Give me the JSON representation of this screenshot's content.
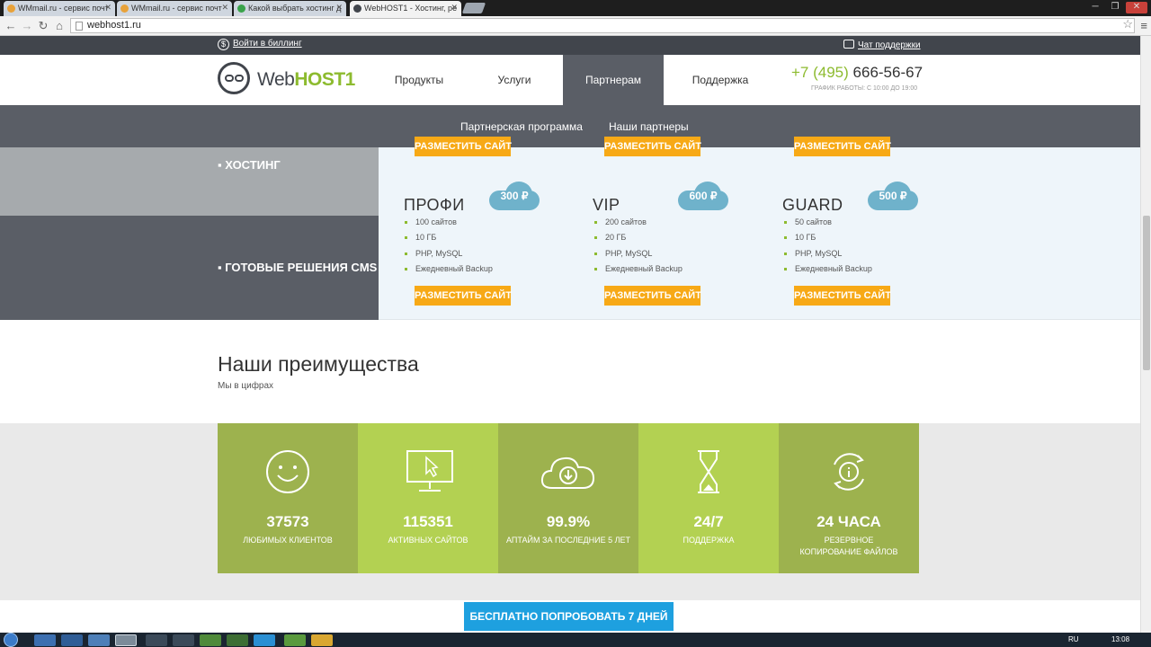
{
  "browser": {
    "tabs": [
      {
        "title": "WMmail.ru - сервис почт",
        "active": false
      },
      {
        "title": "WMmail.ru - сервис почт",
        "active": false
      },
      {
        "title": "Какой выбрать хостинг д",
        "active": false
      },
      {
        "title": "WebHOST1 - Хостинг, ре",
        "active": true
      }
    ],
    "url": "webhost1.ru"
  },
  "topstrip": {
    "billing": "Войти в биллинг",
    "support_chat": "Чат поддержки"
  },
  "header": {
    "logo_web": "Web",
    "logo_host": "HOST1",
    "nav": [
      {
        "label": "Продукты",
        "active": false
      },
      {
        "label": "Услуги",
        "active": false
      },
      {
        "label": "Партнерам",
        "active": true
      },
      {
        "label": "Поддержка",
        "active": false
      }
    ],
    "phone_code": "+7 (495)",
    "phone_number": "666-56-67",
    "hours": "ГРАФИК РАБОТЫ: С 10:00 ДО 19:00"
  },
  "subnav": [
    "Партнерская программа",
    "Наши партнеры"
  ],
  "plans": {
    "categories": [
      "ХОСТИНГ",
      "ГОТОВЫЕ РЕШЕНИЯ CMS"
    ],
    "button_label": "РАЗМЕСТИТЬ САЙТ",
    "items": [
      {
        "name": "ПРОФИ",
        "price": "300 ₽",
        "features": [
          "100 сайтов",
          "10 ГБ",
          "PHP, MySQL",
          "Ежедневный Backup"
        ]
      },
      {
        "name": "VIP",
        "price": "600 ₽",
        "features": [
          "200 сайтов",
          "20 ГБ",
          "PHP, MySQL",
          "Ежедневный Backup"
        ]
      },
      {
        "name": "GUARD",
        "price": "500 ₽",
        "features": [
          "50 сайтов",
          "10 ГБ",
          "PHP, MySQL",
          "Ежедневный Backup"
        ]
      }
    ]
  },
  "advantages": {
    "title": "Наши преимущества",
    "subtitle": "Мы в цифрах",
    "stats": [
      {
        "value": "37573",
        "label": "ЛЮБИМЫХ КЛИЕНТОВ",
        "icon": "smiley-icon",
        "color": "#9db24e"
      },
      {
        "value": "115351",
        "label": "АКТИВНЫХ САЙТОВ",
        "icon": "monitor-icon",
        "color": "#b3d152"
      },
      {
        "value": "99.9%",
        "label": "АПТАЙМ ЗА ПОСЛЕДНИЕ 5 ЛЕТ",
        "icon": "cloud-download-icon",
        "color": "#9db24e"
      },
      {
        "value": "24/7",
        "label": "ПОДДЕРЖКА",
        "icon": "hourglass-icon",
        "color": "#b3d152"
      },
      {
        "value": "24 ЧАСА",
        "label": "РЕЗЕРВНОЕ КОПИРОВАНИЕ ФАЙЛОВ",
        "icon": "backup-cycle-icon",
        "color": "#9db24e"
      }
    ]
  },
  "cta": "БЕСПЛАТНО ПОПРОБОВАТЬ 7 ДНЕЙ",
  "taskbar": {
    "lang": "RU",
    "time": "13:08"
  }
}
